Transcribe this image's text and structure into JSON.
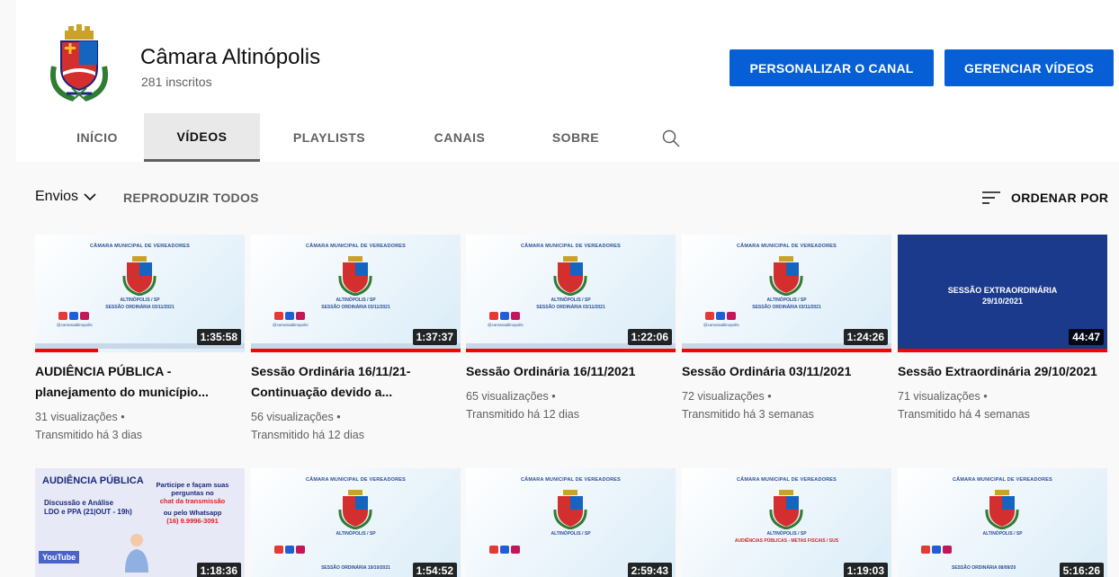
{
  "channel": {
    "name": "Câmara Altinópolis",
    "subscribers": "281 inscritos",
    "customize_label": "PERSONALIZAR O CANAL",
    "manage_label": "GERENCIAR VÍDEOS"
  },
  "tabs": [
    {
      "label": "INÍCIO"
    },
    {
      "label": "VÍDEOS"
    },
    {
      "label": "PLAYLISTS"
    },
    {
      "label": "CANAIS"
    },
    {
      "label": "SOBRE"
    }
  ],
  "toolbar": {
    "uploads_label": "Envios",
    "play_all_label": "REPRODUZIR TODOS",
    "sort_label": "ORDENAR POR"
  },
  "thumb_text": {
    "header": "CÂMARA MUNICIPAL DE VEREADORES",
    "city": "ALTINÓPOLIS / SP",
    "session_03": "SESSÃO ORDINÁRIA 03/11/2021",
    "handle": "@camaraaltinopolis",
    "extra_title": "SESSÃO EXTRAORDINÁRIA",
    "extra_date": "29/10/2021",
    "poster_title": "AUDIÊNCIA PÚBLICA",
    "poster_sub1": "Discussão e Análise",
    "poster_sub2": "LDO e PPA",
    "poster_sub2_date": "(21|OUT - 19h)",
    "poster_right1": "Participe e façam suas perguntas no",
    "poster_right2": "chat da transmissão",
    "poster_right3": "ou pelo Whatsapp",
    "poster_phone": "(16) 9.9996-3091",
    "poster_yt": "YouTube",
    "session_1910": "SESSÃO ORDINÁRIA 19/10/2021",
    "audiencia": "AUDIÊNCIAS PÚBLICAS - METAS FISCAIS / SUS",
    "session_0809": "SESSÃO ORDINÁRIA 08/09/20"
  },
  "videos": [
    {
      "title": "AUDIÊNCIA PÚBLICA - planejamento do município...",
      "views": "31 visualizações •",
      "time": "Transmitido há 3 dias",
      "duration": "1:35:58",
      "watched": 0.3
    },
    {
      "title": "Sessão Ordinária 16/11/21- Continuação devido a...",
      "views": "56 visualizações •",
      "time": "Transmitido há 12 dias",
      "duration": "1:37:37",
      "watched": 1.0
    },
    {
      "title": "Sessão Ordinária 16/11/2021",
      "views": "65 visualizações •",
      "time": "Transmitido há 12 dias",
      "duration": "1:22:06",
      "watched": 1.0
    },
    {
      "title": "Sessão Ordinária 03/11/2021",
      "views": "72 visualizações •",
      "time": "Transmitido há 3 semanas",
      "duration": "1:24:26",
      "watched": 1.0
    },
    {
      "title": "Sessão Extraordinária 29/10/2021",
      "views": "71 visualizações •",
      "time": "Transmitido há 4 semanas",
      "duration": "44:47",
      "watched": 1.0
    },
    {
      "duration": "1:18:36"
    },
    {
      "duration": "1:54:52"
    },
    {
      "duration": "2:59:43"
    },
    {
      "duration": "1:19:03"
    },
    {
      "duration": "5:16:26"
    }
  ],
  "colors": {
    "accent": "#065fd4",
    "progress": "#ff0000"
  }
}
